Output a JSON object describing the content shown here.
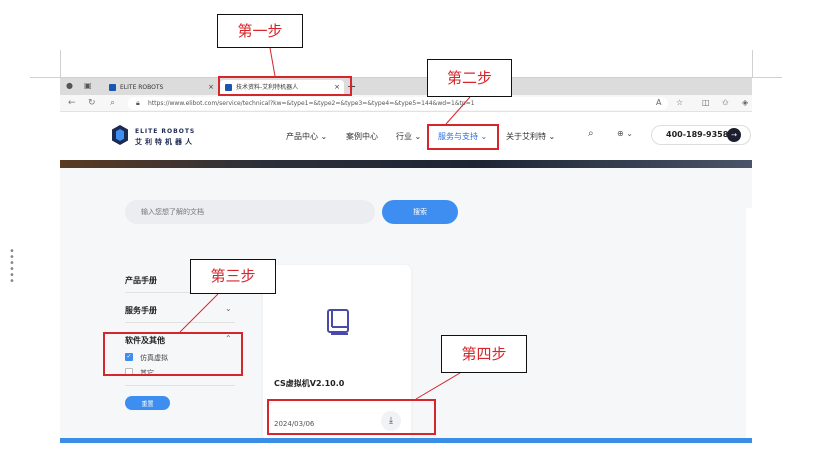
{
  "browser": {
    "tabs": [
      {
        "title": "ELITE ROBOTS",
        "active": false
      },
      {
        "title": "技术资料-艾利特机器人",
        "active": true
      }
    ],
    "url": "https://www.elibot.com/service/technical?kw=&type1=&type2=&type3=&type4=&type5=144&wd=1&tp=1",
    "close_glyph": "×",
    "newtab_glyph": "+"
  },
  "site": {
    "logo_en": "ELITE ROBOTS",
    "logo_cn": "艾利特机器人",
    "menu": [
      "产品中心",
      "案例中心",
      "行业",
      "服务与支持",
      "关于艾利特"
    ],
    "chevron": "⌄",
    "phone": "400-189-9358",
    "accent": "#3d8ef0",
    "dark": "#1c2a52"
  },
  "search": {
    "placeholder": "输入您想了解的文档",
    "button": "搜索"
  },
  "sidebar": {
    "categories": [
      "产品手册",
      "服务手册",
      "软件及其他"
    ],
    "options": [
      {
        "label": "仿真虚拟",
        "checked": true
      },
      {
        "label": "其它",
        "checked": false
      }
    ],
    "reset": "重置"
  },
  "card": {
    "title": "CS虚拟机V2.10.0",
    "date": "2024/03/06",
    "icon": "book-icon"
  },
  "annotations": {
    "step1": "第一步",
    "step2": "第二步",
    "step3": "第三步",
    "step4": "第四步",
    "color": "#d6262b"
  }
}
